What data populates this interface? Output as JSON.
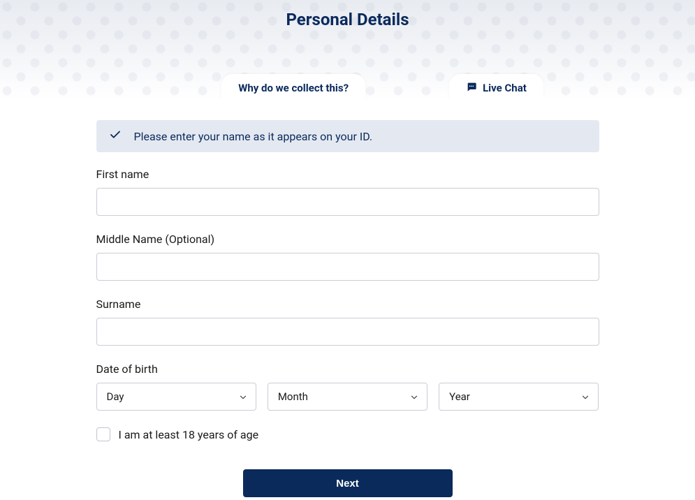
{
  "header": {
    "title": "Personal Details",
    "why_link": "Why do we collect this?",
    "live_chat": "Live Chat"
  },
  "banner": {
    "text": "Please enter your name as it appears on your ID."
  },
  "form": {
    "first_name": {
      "label": "First name",
      "value": ""
    },
    "middle_name": {
      "label": "Middle Name (Optional)",
      "value": ""
    },
    "surname": {
      "label": "Surname",
      "value": ""
    },
    "dob": {
      "label": "Date of birth",
      "day": {
        "placeholder": "Day"
      },
      "month": {
        "placeholder": "Month"
      },
      "year": {
        "placeholder": "Year"
      }
    },
    "age_confirm": {
      "label": "I am at least 18 years of age"
    },
    "next_button": "Next"
  }
}
